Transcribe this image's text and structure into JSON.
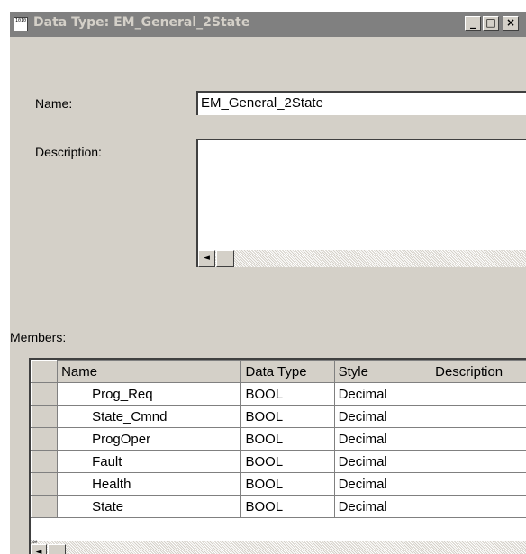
{
  "window": {
    "title": "Data Type: EM_General_2State",
    "app_icon_text": "1010",
    "controls": {
      "minimize": "_",
      "maximize": "□",
      "close": "×"
    }
  },
  "form": {
    "name_label": "Name:",
    "name_value": "EM_General_2State",
    "description_label": "Description:",
    "description_value": "",
    "members_label": "Members:"
  },
  "members_table": {
    "columns": [
      "Name",
      "Data Type",
      "Style",
      "Description"
    ],
    "rows": [
      {
        "name": "Prog_Req",
        "data_type": "BOOL",
        "style": "Decimal",
        "description": ""
      },
      {
        "name": "State_Cmnd",
        "data_type": "BOOL",
        "style": "Decimal",
        "description": ""
      },
      {
        "name": "ProgOper",
        "data_type": "BOOL",
        "style": "Decimal",
        "description": ""
      },
      {
        "name": "Fault",
        "data_type": "BOOL",
        "style": "Decimal",
        "description": ""
      },
      {
        "name": "Health",
        "data_type": "BOOL",
        "style": "Decimal",
        "description": ""
      },
      {
        "name": "State",
        "data_type": "BOOL",
        "style": "Decimal",
        "description": ""
      }
    ],
    "scroll_icon_text": "10#"
  },
  "icons": {
    "scroll_left": "◄",
    "app": "data-type-icon"
  },
  "colors": {
    "dialog_face": "#d4d0c8",
    "titlebar_inactive": "#808080",
    "field_background": "#ffffff"
  }
}
